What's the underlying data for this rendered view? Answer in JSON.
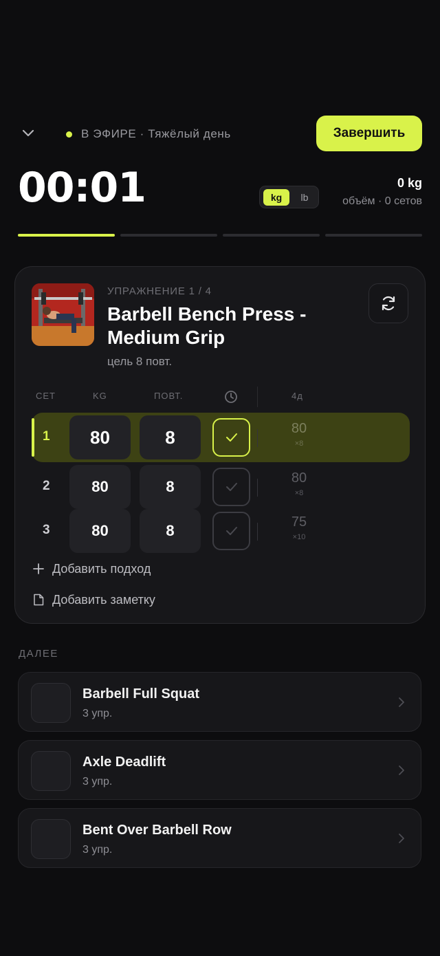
{
  "header": {
    "live_status": "В ЭФИРЕ · Тяжёлый день",
    "finish_label": "Завершить",
    "timer": "00:01",
    "units": {
      "kg": "kg",
      "lb": "lb",
      "selected": "kg"
    },
    "volume_value": "0 kg",
    "volume_label": "объём · 0 сетов"
  },
  "progress": {
    "segments": 4,
    "active": 1
  },
  "exercise": {
    "counter": "УПРАЖНЕНИЕ 1 / 4",
    "title": "Barbell Bench Press - Medium Grip",
    "target": "цель 8 повт.",
    "columns": {
      "set": "СЕТ",
      "kg": "KG",
      "reps": "ПОВТ.",
      "prev": "4д"
    },
    "sets": [
      {
        "num": "1",
        "kg": "80",
        "reps": "8",
        "prev_weight": "80",
        "prev_reps": "×8",
        "active": true
      },
      {
        "num": "2",
        "kg": "80",
        "reps": "8",
        "prev_weight": "80",
        "prev_reps": "×8",
        "active": false
      },
      {
        "num": "3",
        "kg": "80",
        "reps": "8",
        "prev_weight": "75",
        "prev_reps": "×10",
        "active": false
      }
    ],
    "add_set": "Добавить подход",
    "add_note": "Добавить заметку"
  },
  "next": {
    "label": "ДАЛЕЕ",
    "items": [
      {
        "name": "Barbell Full Squat",
        "count": "3 упр."
      },
      {
        "name": "Axle Deadlift",
        "count": "3 упр."
      },
      {
        "name": "Bent Over Barbell Row",
        "count": "3 упр."
      }
    ]
  },
  "colors": {
    "accent": "#d9f24a",
    "background": "#0d0d0f",
    "card": "#17171a",
    "active_row": "#3d4214"
  },
  "icons": [
    "chevron-down-icon",
    "live-dot-icon",
    "swap-icon",
    "clock-icon",
    "check-icon",
    "plus-icon",
    "note-icon",
    "chevron-right-icon"
  ]
}
